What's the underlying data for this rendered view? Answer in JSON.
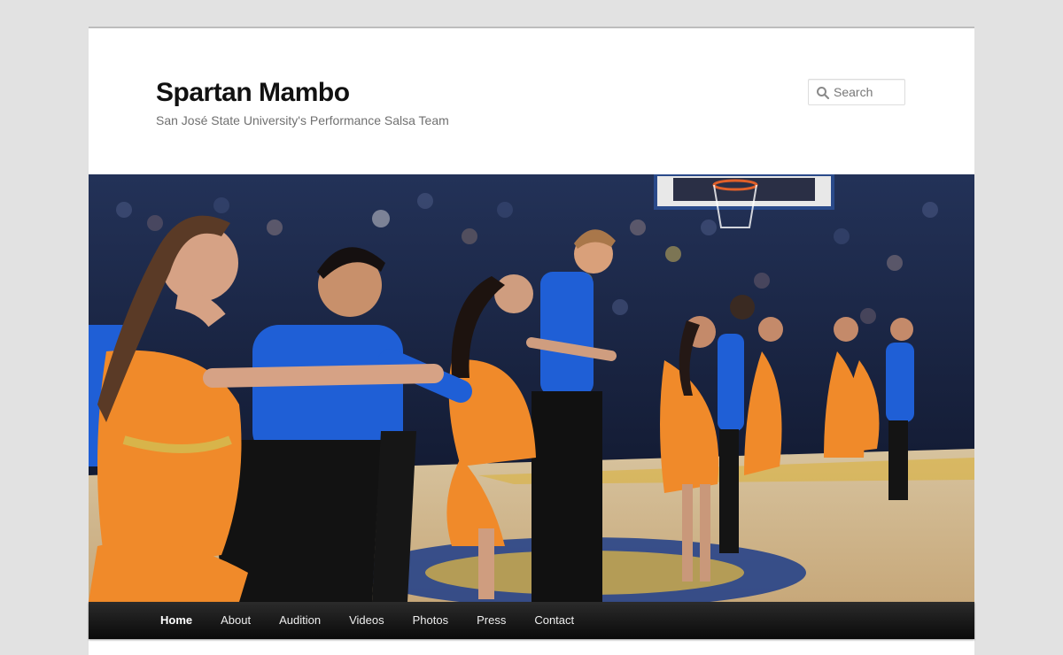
{
  "site": {
    "title": "Spartan Mambo",
    "description": "San José State University's Performance Salsa Team"
  },
  "search": {
    "placeholder": "Search",
    "icon": "search-icon"
  },
  "header_image": {
    "alt_subject": "salsa dancers performing on basketball court",
    "colors": {
      "costume_orange": "#f08a2a",
      "shirt_blue": "#1f5fd6",
      "court": "#cdb48c",
      "crowd": "#1d2a4f"
    }
  },
  "menu": {
    "items": [
      {
        "label": "Home",
        "current": true
      },
      {
        "label": "About"
      },
      {
        "label": "Audition"
      },
      {
        "label": "Videos"
      },
      {
        "label": "Photos"
      },
      {
        "label": "Press"
      },
      {
        "label": "Contact"
      }
    ]
  }
}
